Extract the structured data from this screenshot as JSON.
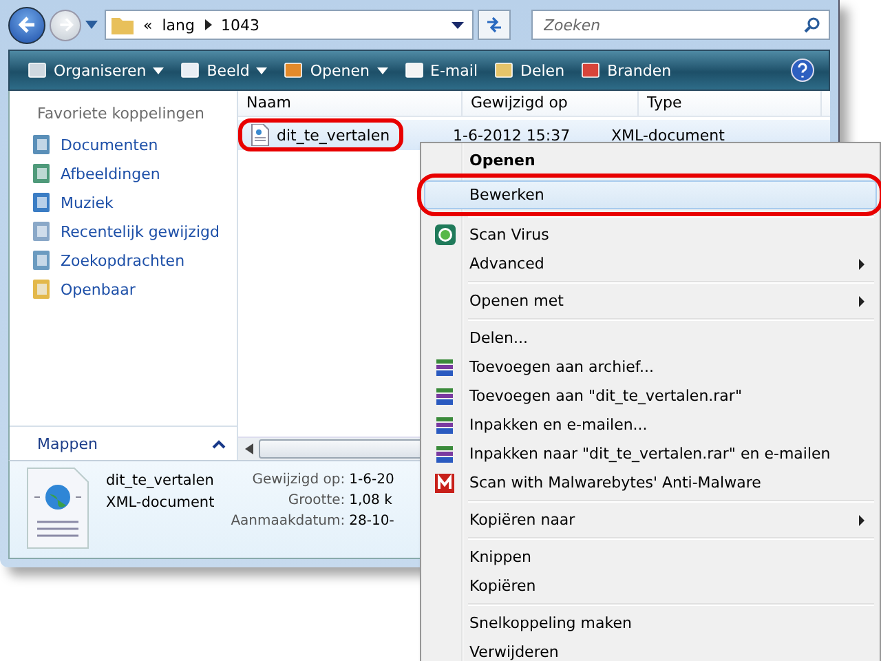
{
  "address_bar": {
    "overflow": "«",
    "path": [
      "lang",
      "1043"
    ]
  },
  "search": {
    "placeholder": "Zoeken"
  },
  "toolbar": [
    {
      "label": "Organiseren",
      "kind": "organize",
      "dropdown": true
    },
    {
      "label": "Beeld",
      "kind": "views",
      "dropdown": true
    },
    {
      "label": "Openen",
      "kind": "open",
      "dropdown": true
    },
    {
      "label": "E-mail",
      "kind": "email",
      "dropdown": false
    },
    {
      "label": "Delen",
      "kind": "share",
      "dropdown": false
    },
    {
      "label": "Branden",
      "kind": "burn",
      "dropdown": false
    }
  ],
  "sidebar": {
    "heading": "Favoriete koppelingen",
    "items": [
      {
        "label": "Documenten",
        "kind": "documents"
      },
      {
        "label": "Afbeeldingen",
        "kind": "pictures"
      },
      {
        "label": "Muziek",
        "kind": "music"
      },
      {
        "label": "Recentelijk gewijzigd",
        "kind": "recent"
      },
      {
        "label": "Zoekopdrachten",
        "kind": "searches"
      },
      {
        "label": "Openbaar",
        "kind": "folder"
      }
    ],
    "footer": "Mappen"
  },
  "table": {
    "columns": [
      "Naam",
      "Gewijzigd op",
      "Type"
    ],
    "rows": [
      {
        "name": "dit_te_vertalen",
        "modified": "1-6-2012 15:37",
        "type": "XML-document",
        "selected": true,
        "highlighted": true
      }
    ]
  },
  "details": {
    "name": "dit_te_vertalen",
    "type": "XML-document",
    "fields": [
      {
        "label": "Gewijzigd op:",
        "value": "1-6-20"
      },
      {
        "label": "Grootte:",
        "value": "1,08 k"
      },
      {
        "label": "Aanmaakdatum:",
        "value": "28-10-"
      }
    ]
  },
  "context_menu": [
    {
      "kind": "default",
      "label": "Openen",
      "selected": false,
      "highlighted": false
    },
    {
      "kind": "plain",
      "label": "Bewerken",
      "selected": true,
      "highlighted": true
    },
    {
      "kind": "separator"
    },
    {
      "kind": "scanner",
      "label": "Scan Virus",
      "selected": false,
      "highlighted": false
    },
    {
      "kind": "submenu",
      "label": "Advanced",
      "selected": false,
      "highlighted": false
    },
    {
      "kind": "separator"
    },
    {
      "kind": "submenu",
      "label": "Openen met",
      "selected": false,
      "highlighted": false
    },
    {
      "kind": "separator"
    },
    {
      "kind": "plain",
      "label": "Delen...",
      "selected": false,
      "highlighted": false
    },
    {
      "kind": "archive",
      "label": "Toevoegen aan archief...",
      "selected": false,
      "highlighted": false
    },
    {
      "kind": "archive",
      "label": "Toevoegen aan \"dit_te_vertalen.rar\"",
      "selected": false,
      "highlighted": false
    },
    {
      "kind": "archive",
      "label": "Inpakken en e-mailen...",
      "selected": false,
      "highlighted": false
    },
    {
      "kind": "archive",
      "label": "Inpakken naar \"dit_te_vertalen.rar\" en e-mailen",
      "selected": false,
      "highlighted": false
    },
    {
      "kind": "antimalware",
      "label": "Scan with Malwarebytes' Anti-Malware",
      "selected": false,
      "highlighted": false
    },
    {
      "kind": "separator"
    },
    {
      "kind": "submenu",
      "label": "Kopiëren naar",
      "selected": false,
      "highlighted": false
    },
    {
      "kind": "separator"
    },
    {
      "kind": "plain",
      "label": "Knippen",
      "selected": false,
      "highlighted": false
    },
    {
      "kind": "plain",
      "label": "Kopiëren",
      "selected": false,
      "highlighted": false
    },
    {
      "kind": "separator"
    },
    {
      "kind": "plain",
      "label": "Snelkoppeling maken",
      "selected": false,
      "highlighted": false
    },
    {
      "kind": "plain",
      "label": "Verwijderen",
      "selected": false,
      "highlighted": false
    }
  ]
}
